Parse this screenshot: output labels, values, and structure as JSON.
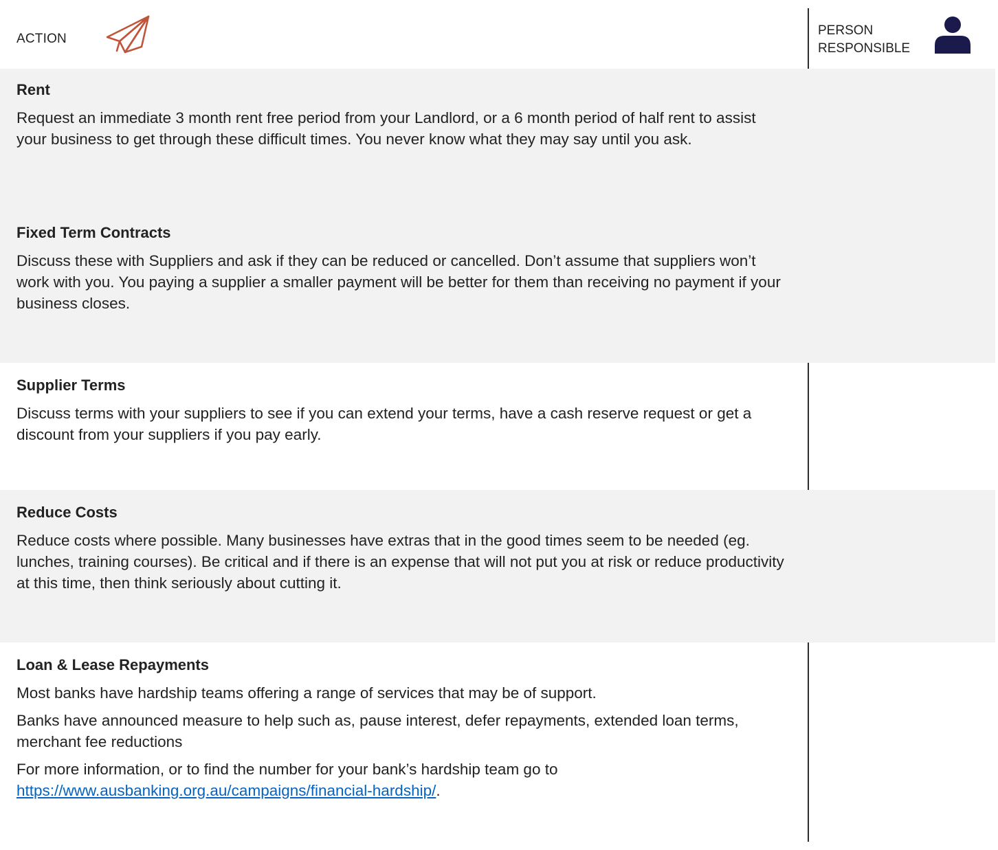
{
  "header": {
    "action_label": "ACTION",
    "person_label_line1": "PERSON",
    "person_label_line2": "RESPONSIBLE",
    "plane_icon": "paper-plane-icon",
    "person_icon": "person-icon",
    "plane_color": "#c0553b",
    "person_color": "#1a1a4d"
  },
  "colors": {
    "shaded_row": "#f2f2f2",
    "link": "#0563c1",
    "divider": "#2b2b2b"
  },
  "rows": [
    {
      "title": "Rent",
      "paragraphs": [
        "Request an immediate 3 month rent free period from your Landlord, or a 6 month period of half rent to assist your business to get through these difficult times. You never know what they may say until you ask."
      ]
    },
    {
      "title": "Fixed Term Contracts",
      "paragraphs": [
        "Discuss these with Suppliers and ask if they can be reduced or cancelled. Don’t assume that suppliers won’t work with you. You paying a supplier a smaller payment will be better for them than receiving no payment if your business closes."
      ]
    },
    {
      "title": "Supplier Terms",
      "paragraphs": [
        "Discuss terms with your suppliers to see if you can extend your terms, have a cash reserve request or get a discount from your suppliers if you pay early."
      ]
    },
    {
      "title": "Reduce Costs",
      "paragraphs": [
        "Reduce costs where possible. Many businesses have extras that in the good times seem to be needed (eg. lunches, training courses). Be critical and if there is an expense that will not put you at risk or reduce productivity at this time, then think seriously about cutting it."
      ]
    },
    {
      "title": "Loan & Lease Repayments",
      "paragraphs": [
        "Most banks have hardship teams offering a range of services that may be of support.",
        "Banks have announced measure to help such as, pause interest, defer repayments, extended loan terms, merchant fee reductions",
        "For more information, or to find the number for your bank’s hardship team go to"
      ],
      "link_text": "https://www.ausbanking.org.au/campaigns/financial-hardship/",
      "link_suffix": "."
    }
  ]
}
